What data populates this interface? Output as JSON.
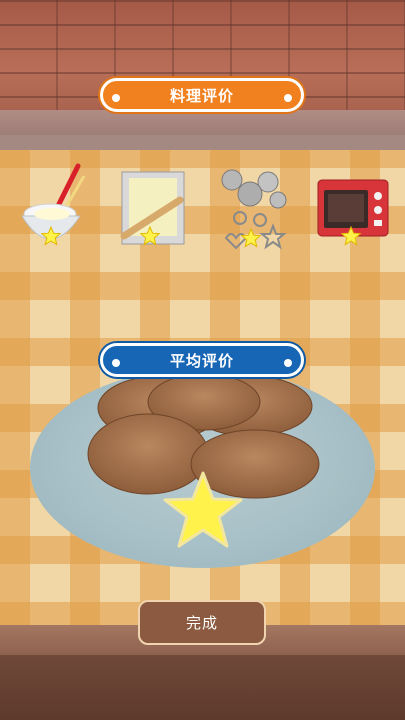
{
  "header": {
    "cooking_rating_label": "料理评价"
  },
  "average": {
    "average_rating_label": "平均评价"
  },
  "tools": [
    {
      "name": "whisk-bowl",
      "stars": 1
    },
    {
      "name": "dough-board",
      "stars": 1
    },
    {
      "name": "cookie-cutters",
      "stars": 1
    },
    {
      "name": "oven",
      "stars": 1
    }
  ],
  "result": {
    "stars": 1
  },
  "footer": {
    "finish_label": "完成"
  },
  "colors": {
    "orange": "#f1801f",
    "blue": "#1766b5",
    "star": "#fff24a",
    "button": "#8b5a40"
  }
}
